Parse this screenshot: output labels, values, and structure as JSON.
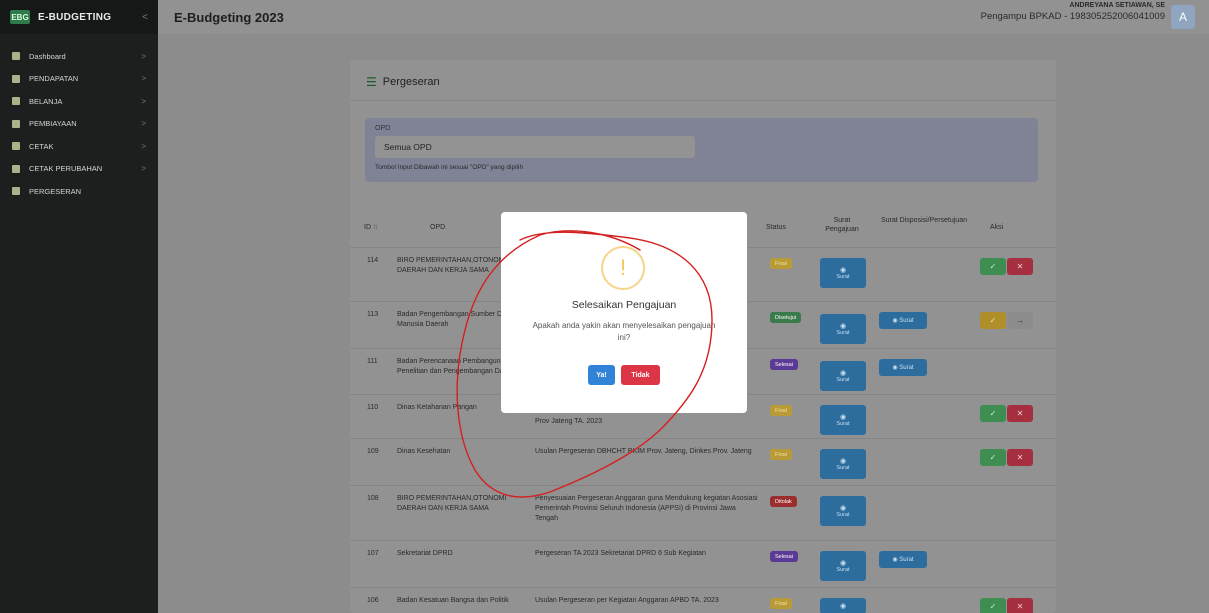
{
  "brand": {
    "logo": "EBG",
    "name": "E-BUDGETING",
    "toggle": "<"
  },
  "sidebar": {
    "items": [
      {
        "label": "Dashboard",
        "arrow": ">"
      },
      {
        "label": "PENDAPATAN",
        "arrow": ">"
      },
      {
        "label": "BELANJA",
        "arrow": ">"
      },
      {
        "label": "PEMBIAYAAN",
        "arrow": ">"
      },
      {
        "label": "CETAK",
        "arrow": ">"
      },
      {
        "label": "CETAK PERUBAHAN",
        "arrow": ">"
      },
      {
        "label": "PERGESERAN",
        "arrow": ""
      }
    ]
  },
  "topbar": {
    "title": "E-Budgeting 2023",
    "user_name": "ANDREYANA SETIAWAN, SE",
    "user_role": "Pengampu BPKAD - 198305252006041009",
    "avatar": "A"
  },
  "card": {
    "icon": "list-icon",
    "title": "Pergeseran",
    "filter_label": "OPD",
    "filter_value": "Semua OPD",
    "filter_hint": "Tombol Input Dibawah ini sesuai \"OPD\" yang dipilih"
  },
  "table": {
    "headers": {
      "id": "ID",
      "opd": "OPD",
      "status": "Status",
      "surat_pengajuan": "Surat Pengajuan",
      "surat_disposisi": "Surat Disposisi/Persetujuan",
      "aksi": "Aksi"
    },
    "surat_label": "Surat",
    "rows": [
      {
        "id": "114",
        "opd": "BIRO PEMERINTAHAN,OTONOMI DAERAH DAN KERJA SAMA",
        "ket": "",
        "status": "Final"
      },
      {
        "id": "113",
        "opd": "Badan Pengembangan Sumber Daya Manusia Daerah",
        "ket": "",
        "status": "Disetujui"
      },
      {
        "id": "111",
        "opd": "Badan Perencanaan Pembangunan, Penelitian dan Pengembangan Daerah",
        "ket": "",
        "status": "Selesai"
      },
      {
        "id": "110",
        "opd": "Dinas Ketahanan Pangan",
        "ket": "Prov Jateng TA. 2023",
        "status": "Final"
      },
      {
        "id": "109",
        "opd": "Dinas Kesehatan",
        "ket": "Usulan Pergeseran DBHCHT BKIM Prov. Jateng, Dinkes Prov. Jateng",
        "status": "Final"
      },
      {
        "id": "108",
        "opd": "BIRO PEMERINTAHAN,OTONOMI DAERAH DAN KERJA SAMA",
        "ket": "Penyesuaian Pergeseran Anggaran guna Mendukung kegiatan Asosiasi Pemerintah Provinsi Seluruh Indonesia (APPSI) di Provinsi Jawa Tengah",
        "status": "Ditolak"
      },
      {
        "id": "107",
        "opd": "Sekretariat DPRD",
        "ket": "Pergeseran TA 2023 Sekretariat DPRD 6 Sub Kegiatan",
        "status": "Selesai"
      },
      {
        "id": "106",
        "opd": "Badan Kesatuan Bangsa dan Politik",
        "ket": "Usulan Pergeseran per Kegiatan Anggaran APBD TA. 2023",
        "status": "Final"
      }
    ]
  },
  "modal": {
    "icon": "!",
    "title": "Selesaikan Pengajuan",
    "text": "Apakah anda yakin akan menyelesaikan pengajuan ini?",
    "yes": "Ya!",
    "no": "Tidak"
  },
  "colors": {
    "sidebar": "#1d1f1e",
    "primary": "#3083d7",
    "danger": "#dc3545",
    "warning": "#f6d58a",
    "annotation": "#d42020"
  }
}
